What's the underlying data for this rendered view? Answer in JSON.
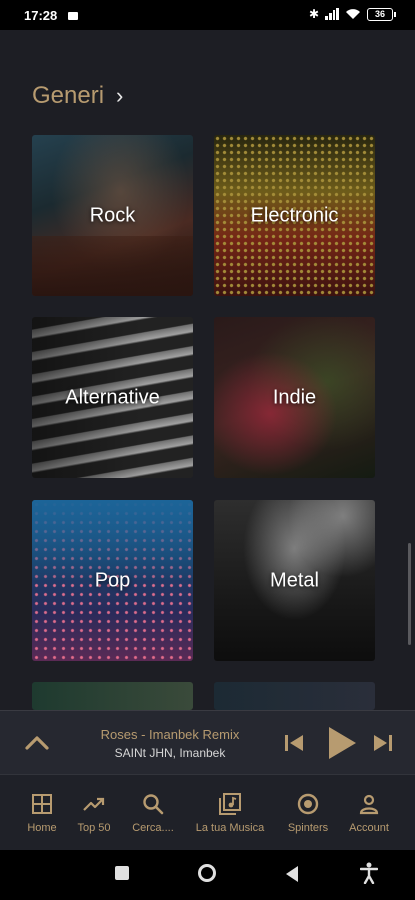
{
  "status_bar": {
    "time": "17:28",
    "battery": "36",
    "icons": [
      "message-icon",
      "bluetooth-icon",
      "signal-icon",
      "wifi-icon",
      "battery-icon"
    ]
  },
  "section": {
    "title": "Generi"
  },
  "genres": [
    {
      "label": "Rock"
    },
    {
      "label": "Electronic"
    },
    {
      "label": "Alternative"
    },
    {
      "label": "Indie"
    },
    {
      "label": "Pop"
    },
    {
      "label": "Metal"
    }
  ],
  "player": {
    "title": "Roses - Imanbek Remix",
    "artist": "SAINt JHN, Imanbek"
  },
  "nav": {
    "items": [
      {
        "label": "Home",
        "icon": "grid-icon"
      },
      {
        "label": "Top 50",
        "icon": "trending-icon"
      },
      {
        "label": "Cerca....",
        "icon": "search-icon"
      },
      {
        "label": "La tua Musica",
        "icon": "library-icon"
      },
      {
        "label": "Spinters",
        "icon": "record-icon"
      },
      {
        "label": "Account",
        "icon": "person-icon"
      }
    ]
  },
  "colors": {
    "accent": "#b79b70",
    "background": "#1d1e24",
    "player_bg": "#262830"
  }
}
